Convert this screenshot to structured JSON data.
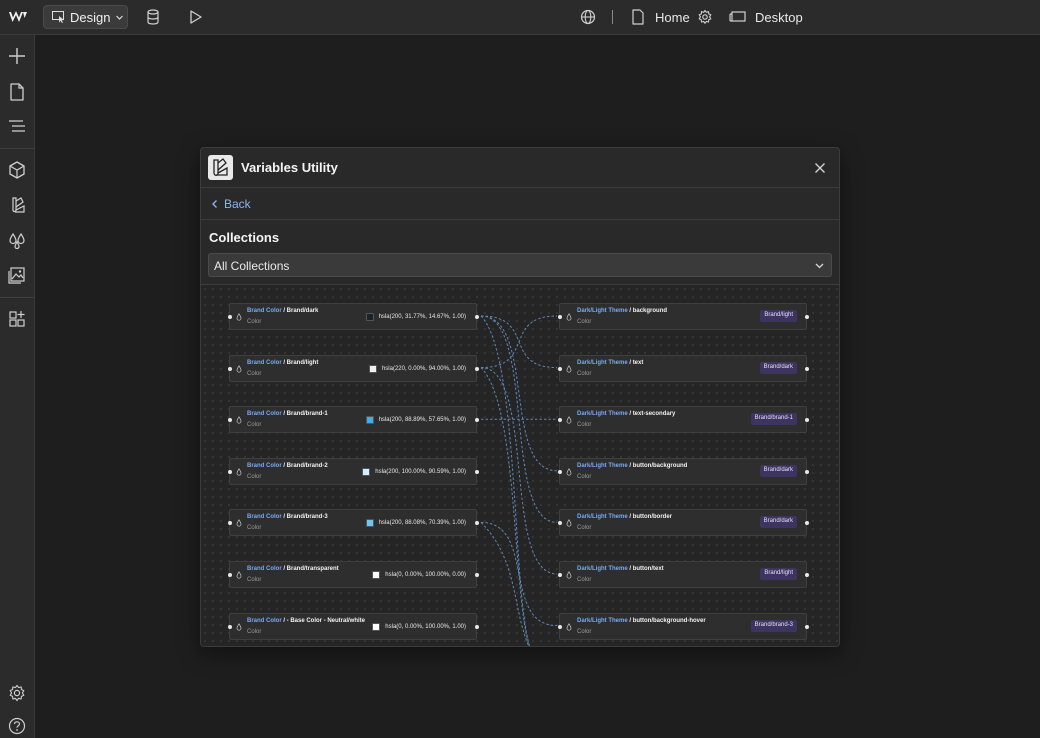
{
  "topbar": {
    "mode_label": "Design",
    "page_label": "Home",
    "breakpoint_label": "Desktop"
  },
  "panel": {
    "title": "Variables Utility",
    "back_label": "Back",
    "collections_label": "Collections",
    "collections_select": "All Collections"
  },
  "graph": {
    "left_nodes": [
      {
        "collection": "Brand Color",
        "name": "/ Brand/dark",
        "type": "Color",
        "value": "hsla(200, 31.77%, 14.67%, 1.00)",
        "swatch": "#19252b"
      },
      {
        "collection": "Brand Color",
        "name": "/ Brand/light",
        "type": "Color",
        "value": "hsla(220, 0.00%, 94.00%, 1.00)",
        "swatch": "#f0f0f0"
      },
      {
        "collection": "Brand Color",
        "name": "/ Brand/brand-1",
        "type": "Color",
        "value": "hsla(200, 88.89%, 57.65%, 1.00)",
        "swatch": "#3bb0f0"
      },
      {
        "collection": "Brand Color",
        "name": "/ Brand/brand-2",
        "type": "Color",
        "value": "hsla(200, 100.00%, 90.59%, 1.00)",
        "swatch": "#cfeeff"
      },
      {
        "collection": "Brand Color",
        "name": "/ Brand/brand-3",
        "type": "Color",
        "value": "hsla(200, 88.08%, 70.39%, 1.00)",
        "swatch": "#6cc7f5"
      },
      {
        "collection": "Brand Color",
        "name": "/ Brand/transparent",
        "type": "Color",
        "value": "hsla(0, 0.00%, 100.00%, 0.00)",
        "swatch": "#ffffff"
      },
      {
        "collection": "Brand Color",
        "name": "/ - Base Color - Neutral/white",
        "type": "Color",
        "value": "hsla(0, 0.00%, 100.00%, 1.00)",
        "swatch": "#ffffff"
      }
    ],
    "right_nodes": [
      {
        "collection": "Dark/Light Theme",
        "name": "/ background",
        "type": "Color",
        "badge": "Brand/light"
      },
      {
        "collection": "Dark/Light Theme",
        "name": "/ text",
        "type": "Color",
        "badge": "Brand/dark"
      },
      {
        "collection": "Dark/Light Theme",
        "name": "/ text-secondary",
        "type": "Color",
        "badge": "Brand/brand-1"
      },
      {
        "collection": "Dark/Light Theme",
        "name": "/ button/background",
        "type": "Color",
        "badge": "Brand/dark"
      },
      {
        "collection": "Dark/Light Theme",
        "name": "/ button/border",
        "type": "Color",
        "badge": "Brand/dark"
      },
      {
        "collection": "Dark/Light Theme",
        "name": "/ button/text",
        "type": "Color",
        "badge": "Brand/light"
      },
      {
        "collection": "Dark/Light Theme",
        "name": "/ button/background-hover",
        "type": "Color",
        "badge": "Brand/brand-3"
      }
    ],
    "edge_color": "#5f87b8"
  }
}
